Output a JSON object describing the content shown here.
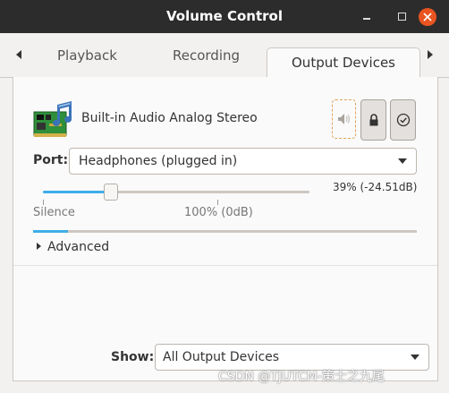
{
  "window": {
    "title": "Volume Control",
    "controls": [
      "minimize-icon",
      "maximize-icon",
      "close-icon"
    ],
    "close_color": "#e95420"
  },
  "tabs": {
    "items": [
      {
        "label": "Playback",
        "active": false
      },
      {
        "label": "Recording",
        "active": false
      },
      {
        "label": "Output Devices",
        "active": true
      }
    ]
  },
  "device": {
    "name": "Built-in Audio Analog Stereo",
    "icon": "sound-card-icon",
    "buttons": [
      "mute-speaker-icon",
      "lock-icon",
      "default-check-icon"
    ]
  },
  "port": {
    "label": "Port:",
    "selected": "Headphones (plugged in)"
  },
  "volume": {
    "readout": "39% (-24.51dB)",
    "level_percent": 39,
    "scale_labels": [
      "Silence",
      "100% (0dB)"
    ],
    "meter_level_fraction": 0.09,
    "accent": "#3daee9"
  },
  "advanced": {
    "label": "Advanced"
  },
  "show": {
    "label": "Show:",
    "selected": "All Output Devices"
  },
  "watermark": "CSDN @TJUTCM-策士之九尾"
}
